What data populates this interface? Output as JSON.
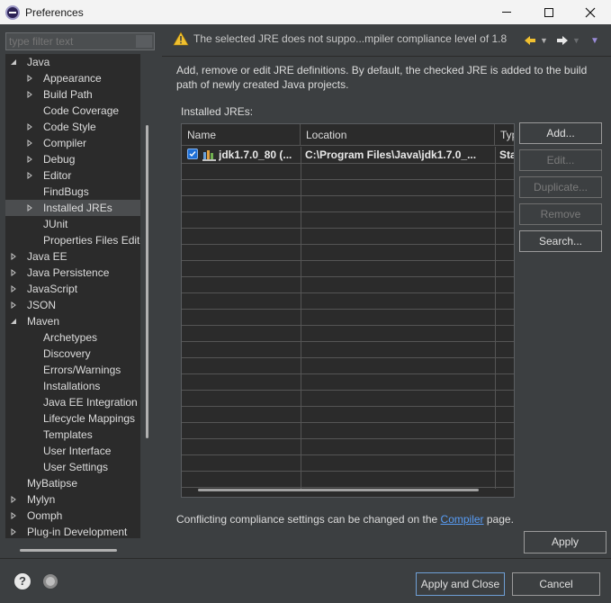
{
  "window": {
    "title": "Preferences"
  },
  "filter": {
    "placeholder": "type filter text"
  },
  "tree": {
    "items": [
      {
        "label": "Java",
        "twisty": "expanded"
      },
      {
        "label": "Appearance",
        "twisty": "collapsed"
      },
      {
        "label": "Build Path",
        "twisty": "collapsed"
      },
      {
        "label": "Code Coverage",
        "twisty": "none"
      },
      {
        "label": "Code Style",
        "twisty": "collapsed"
      },
      {
        "label": "Compiler",
        "twisty": "collapsed"
      },
      {
        "label": "Debug",
        "twisty": "collapsed"
      },
      {
        "label": "Editor",
        "twisty": "collapsed"
      },
      {
        "label": "FindBugs",
        "twisty": "none"
      },
      {
        "label": "Installed JREs",
        "twisty": "collapsed",
        "selected": true
      },
      {
        "label": "JUnit",
        "twisty": "none"
      },
      {
        "label": "Properties Files Editor",
        "twisty": "none"
      },
      {
        "label": "Java EE",
        "twisty": "collapsed"
      },
      {
        "label": "Java Persistence",
        "twisty": "collapsed"
      },
      {
        "label": "JavaScript",
        "twisty": "collapsed"
      },
      {
        "label": "JSON",
        "twisty": "collapsed"
      },
      {
        "label": "Maven",
        "twisty": "expanded"
      },
      {
        "label": "Archetypes",
        "twisty": "none"
      },
      {
        "label": "Discovery",
        "twisty": "none"
      },
      {
        "label": "Errors/Warnings",
        "twisty": "none"
      },
      {
        "label": "Installations",
        "twisty": "none"
      },
      {
        "label": "Java EE Integration",
        "twisty": "none"
      },
      {
        "label": "Lifecycle Mappings",
        "twisty": "none"
      },
      {
        "label": "Templates",
        "twisty": "none"
      },
      {
        "label": "User Interface",
        "twisty": "none"
      },
      {
        "label": "User Settings",
        "twisty": "none"
      },
      {
        "label": "MyBatipse",
        "twisty": "none"
      },
      {
        "label": "Mylyn",
        "twisty": "collapsed"
      },
      {
        "label": "Oomph",
        "twisty": "collapsed"
      },
      {
        "label": "Plug-in Development",
        "twisty": "collapsed"
      }
    ]
  },
  "page": {
    "warning": "The selected JRE does not suppo...mpiler compliance level of 1.8",
    "description": "Add, remove or edit JRE definitions. By default, the checked JRE is added to the build path of newly created Java projects.",
    "installed_label": "Installed JREs:",
    "columns": [
      "Name",
      "Location",
      "Type"
    ],
    "rows": [
      {
        "checked": true,
        "name": "jdk1.7.0_80 (...",
        "location": "C:\\Program Files\\Java\\jdk1.7.0_...",
        "type": "Standard VM"
      }
    ],
    "buttons": {
      "add": "Add...",
      "edit": "Edit...",
      "duplicate": "Duplicate...",
      "remove": "Remove",
      "search": "Search..."
    },
    "conflict_prefix": "Conflicting compliance settings can be changed on the ",
    "conflict_link": "Compiler",
    "conflict_suffix": " page.",
    "apply": "Apply"
  },
  "footer": {
    "help_glyph": "?",
    "apply_and_close": "Apply and Close",
    "cancel": "Cancel"
  },
  "colors": {
    "background": "#3c3f41",
    "list_background": "#2b2b2b",
    "link": "#589df6",
    "warning": "#f0c030"
  }
}
